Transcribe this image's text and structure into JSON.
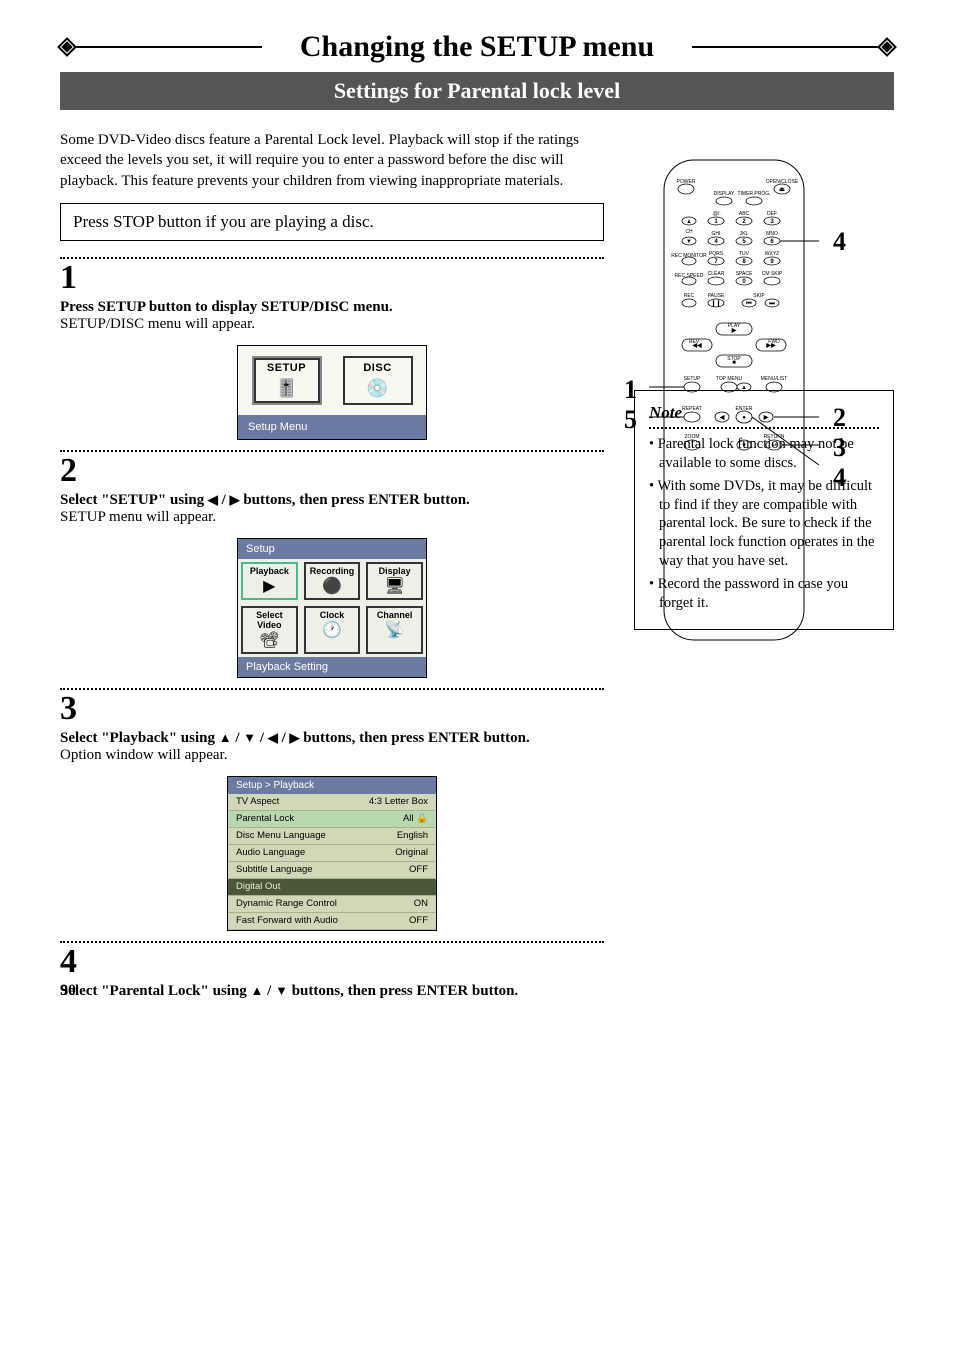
{
  "page_number": "90",
  "title": "Changing the SETUP menu",
  "banner": "Settings for Parental lock level",
  "intro": "Some DVD-Video discs feature a Parental Lock level. Playback will stop if the ratings exceed the levels you set, it will require you to enter a password before the disc will playback. This feature prevents your children from viewing inappropriate materials.",
  "boxed": "Press STOP button if you are playing a disc.",
  "steps": {
    "s1": {
      "num": "1",
      "head": "Press SETUP button to display SETUP/DISC menu.",
      "sub": "SETUP/DISC menu will appear."
    },
    "s2": {
      "num": "2",
      "head_a": "Select \"SETUP\" using ",
      "head_b": " buttons, then press ENTER button.",
      "sub": "SETUP menu will appear."
    },
    "s3": {
      "num": "3",
      "head_a": "Select \"Playback\" using ",
      "head_b": " buttons, then press ENTER button.",
      "sub": "Option window will appear."
    },
    "s4": {
      "num": "4",
      "head_a": "Select \"Parental Lock\" using ",
      "head_b": " buttons, then press ENTER button."
    }
  },
  "osd1": {
    "setup": "SETUP",
    "disc": "DISC",
    "foot": "Setup Menu"
  },
  "osd2": {
    "hdr": "Setup",
    "cells": {
      "c0": "Playback",
      "c1": "Recording",
      "c2": "Display",
      "c3": "Select Video",
      "c4": "Clock",
      "c5": "Channel"
    },
    "foot": "Playback Setting"
  },
  "osd3": {
    "hdr": "Setup > Playback",
    "rows": {
      "r0": {
        "l": "TV Aspect",
        "v": "4:3 Letter Box"
      },
      "r1": {
        "l": "Parental Lock",
        "v": "All   🔒"
      },
      "r2": {
        "l": "Disc Menu Language",
        "v": "English"
      },
      "r3": {
        "l": "Audio Language",
        "v": "Original"
      },
      "r4": {
        "l": "Subtitle Language",
        "v": "OFF"
      },
      "r5": {
        "l": "Digital Out",
        "v": ""
      },
      "r6": {
        "l": "Dynamic Range Control",
        "v": "ON"
      },
      "r7": {
        "l": "Fast Forward with Audio",
        "v": "OFF"
      }
    }
  },
  "note": {
    "title": "Note",
    "n1": "Parental lock function may not be available to some discs.",
    "n2": "With some DVDs, it may be difficult to find if they are compatible with parental lock. Be sure to check if the parental lock function operates in the way that you have set.",
    "n3": "Record the password in case you forget it."
  },
  "remote_callouts": {
    "left_top": "1",
    "left_bot": "5",
    "right_a": "4",
    "right_b": "2",
    "right_c": "3",
    "right_d": "4"
  },
  "remote_labels": {
    "power": "POWER",
    "openclose": "OPEN/CLOSE",
    "display": "DISPLAY",
    "timer": "TIMER PROG.",
    "ch": "CH",
    "abc": "ABC",
    "def": "DEF",
    "ghi": "GHI",
    "jkl": "JKL",
    "mno": "MNO",
    "pqrs": "PQRS",
    "tuv": "TUV",
    "wxyz": "WXYZ",
    "recmon": "REC MONITOR",
    "clear": "CLEAR",
    "space": "SPACE",
    "cmskip": "CM SKIP",
    "recspd": "REC SPEED",
    "rec": "REC",
    "pause": "PAUSE",
    "skip": "SKIP",
    "play": "PLAY",
    "rev": "REV",
    "fwd": "FWD",
    "stop": "STOP",
    "setup": "SETUP",
    "topmenu": "TOP MENU",
    "menulist": "MENU/LIST",
    "repeat": "REPEAT",
    "enter": "ENTER",
    "return": "RETURN",
    "zoom": "ZOOM"
  }
}
